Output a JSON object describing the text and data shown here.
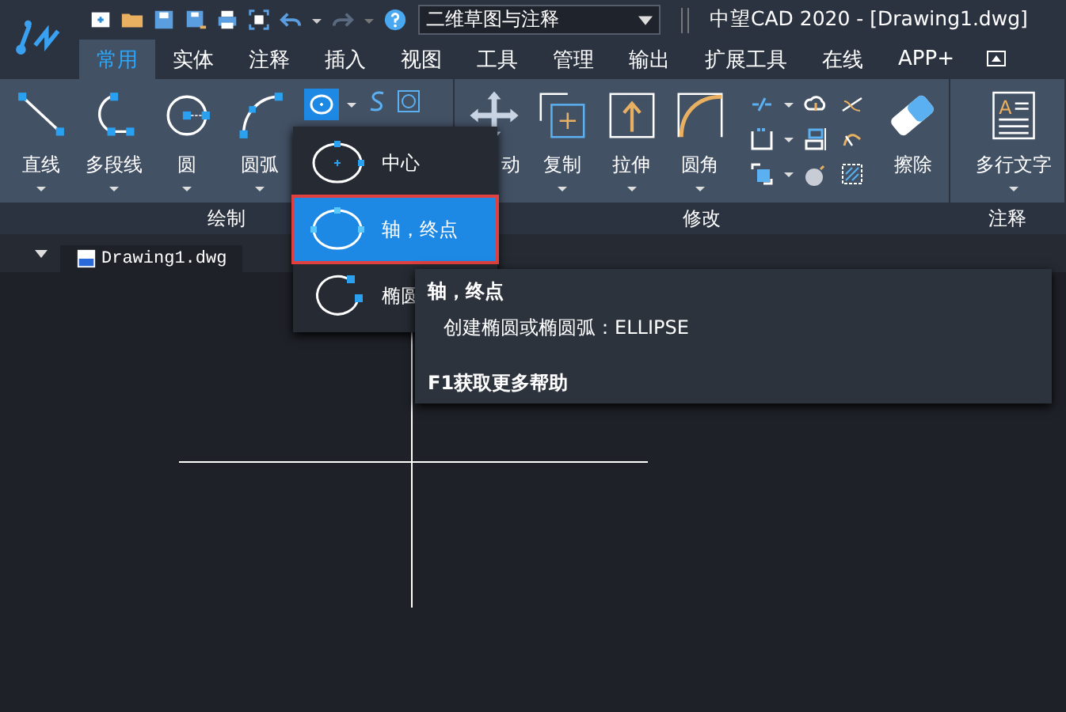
{
  "title_bar": {
    "workspace": "二维草图与注释",
    "title": "中望CAD 2020 - [Drawing1.dwg]"
  },
  "tabs": [
    {
      "label": "常用",
      "selected": true
    },
    {
      "label": "实体",
      "selected": false
    },
    {
      "label": "注释",
      "selected": false
    },
    {
      "label": "插入",
      "selected": false
    },
    {
      "label": "视图",
      "selected": false
    },
    {
      "label": "工具",
      "selected": false
    },
    {
      "label": "管理",
      "selected": false
    },
    {
      "label": "输出",
      "selected": false
    },
    {
      "label": "扩展工具",
      "selected": false
    },
    {
      "label": "在线",
      "selected": false
    },
    {
      "label": "APP+",
      "selected": false
    }
  ],
  "panels": [
    {
      "label": "绘制",
      "tools": [
        {
          "kind": "line",
          "label": "直线",
          "dropdown": true
        },
        {
          "kind": "polyline",
          "label": "多段线",
          "dropdown": true
        },
        {
          "kind": "circle",
          "label": "圆",
          "dropdown": true
        },
        {
          "kind": "arc",
          "label": "圆弧",
          "dropdown": true
        }
      ]
    },
    {
      "label": "修改",
      "tools": [
        {
          "kind": "move",
          "label": "动",
          "dropdown": false
        },
        {
          "kind": "copy",
          "label": "复制",
          "dropdown": true
        },
        {
          "kind": "stretch",
          "label": "拉伸",
          "dropdown": true
        },
        {
          "kind": "fillet",
          "label": "圆角",
          "dropdown": true
        },
        {
          "kind": "grid"
        },
        {
          "kind": "erase",
          "label": "擦除",
          "dropdown": false
        }
      ]
    },
    {
      "label": "注释",
      "tools": [
        {
          "kind": "mtext",
          "label": "多行文字",
          "dropdown": true,
          "icon_text": "A"
        }
      ]
    }
  ],
  "ellipse_menu": {
    "items": [
      {
        "kind": "center",
        "label": "中心",
        "selected": false
      },
      {
        "kind": "axis",
        "label": "轴，终点",
        "selected": true
      },
      {
        "kind": "arc",
        "label": "椭圆",
        "selected": false
      }
    ]
  },
  "tooltip": {
    "title": "轴，终点",
    "description": "创建椭圆或椭圆弧：ELLIPSE",
    "help": "F1获取更多帮助"
  },
  "document_tab": {
    "label": "Drawing1.dwg"
  }
}
